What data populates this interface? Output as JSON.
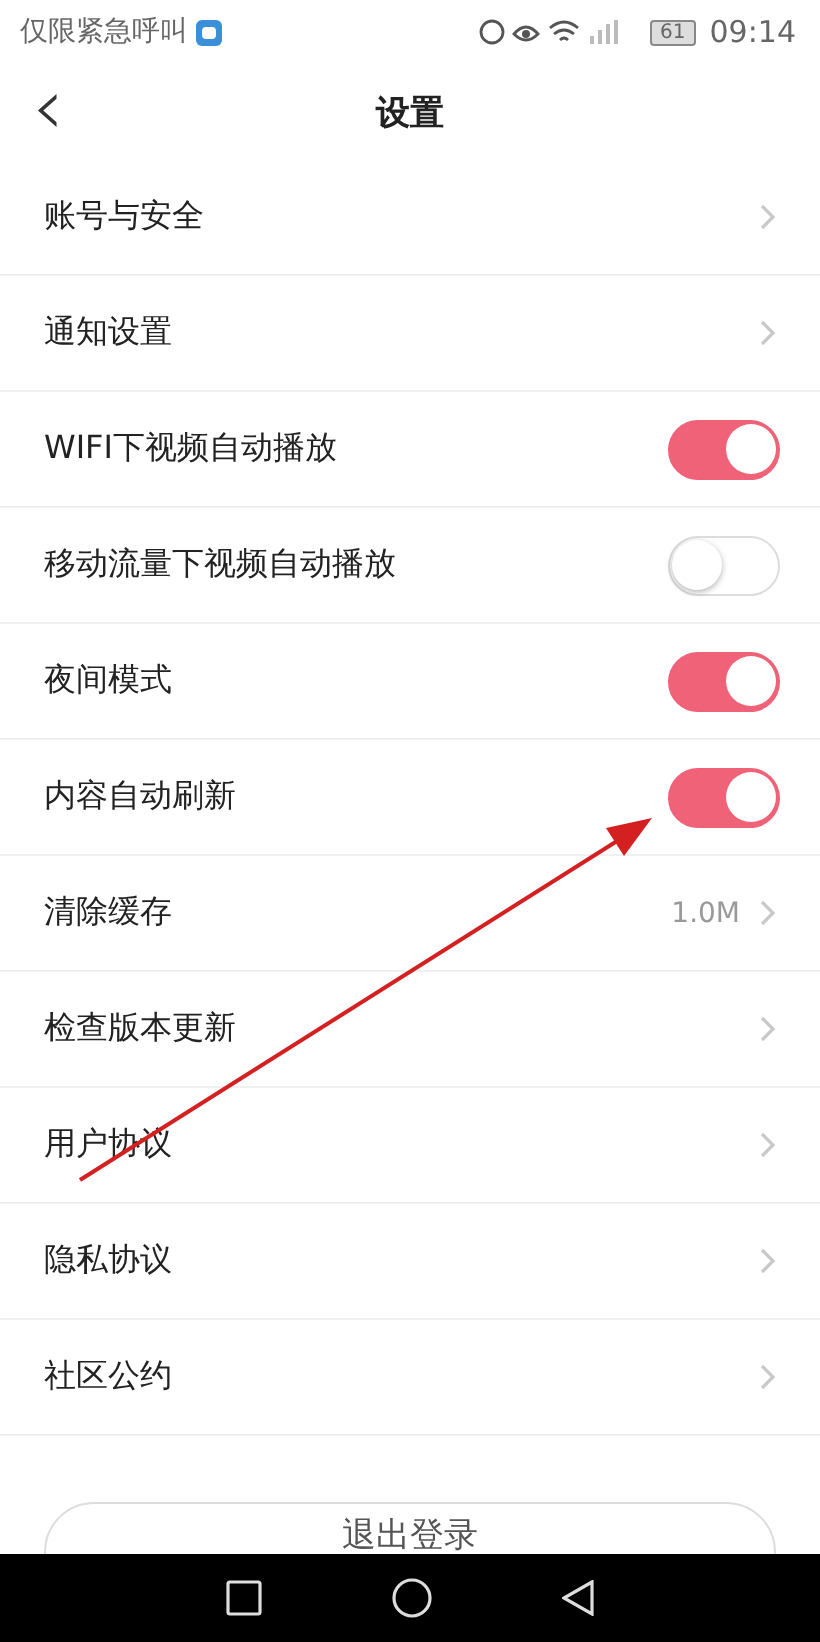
{
  "status_bar": {
    "carrier": "仅限紧急呼叫",
    "battery": "61",
    "time": "09:14"
  },
  "header": {
    "back": "‹",
    "title": "设置"
  },
  "settings": [
    {
      "label": "账号与安全",
      "kind": "link"
    },
    {
      "label": "通知设置",
      "kind": "link"
    },
    {
      "label": "WIFI下视频自动播放",
      "kind": "toggle",
      "on": true
    },
    {
      "label": "移动流量下视频自动播放",
      "kind": "toggle",
      "on": false
    },
    {
      "label": "夜间模式",
      "kind": "toggle",
      "on": true
    },
    {
      "label": "内容自动刷新",
      "kind": "toggle",
      "on": true
    },
    {
      "label": "清除缓存",
      "kind": "link",
      "value": "1.0M"
    },
    {
      "label": "检查版本更新",
      "kind": "link"
    },
    {
      "label": "用户协议",
      "kind": "link"
    },
    {
      "label": "隐私协议",
      "kind": "link"
    },
    {
      "label": "社区公约",
      "kind": "link"
    }
  ],
  "logout_button": "退出登录"
}
